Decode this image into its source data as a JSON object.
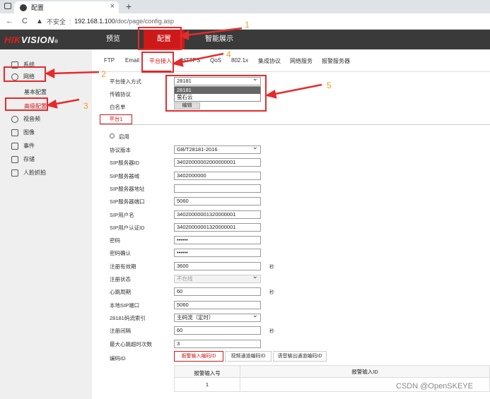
{
  "browser": {
    "tab_title": "配置",
    "new_tab_symbol": "+",
    "close_symbol": "×",
    "security_label": "不安全",
    "url_host": "192.168.1.100",
    "url_path": "/doc/page/config.asp"
  },
  "header": {
    "logo_red": "HIK",
    "logo_white": "VISION",
    "logo_mark": "®",
    "nav": [
      "预览",
      "配置",
      "智能展示"
    ]
  },
  "sidebar": {
    "items": [
      {
        "label": "系统",
        "icon": "monitor-icon"
      },
      {
        "label": "网络",
        "icon": "globe-icon"
      },
      {
        "label": "视音频",
        "icon": "av-icon"
      },
      {
        "label": "图像",
        "icon": "image-icon"
      },
      {
        "label": "事件",
        "icon": "calendar-icon"
      },
      {
        "label": "存储",
        "icon": "storage-icon"
      },
      {
        "label": "人脸抓拍",
        "icon": "face-icon"
      }
    ],
    "network_sub": [
      "基本配置",
      "高级配置"
    ]
  },
  "tabs": [
    "FTP",
    "Email",
    "平台接入",
    "HTTPS",
    "QoS",
    "802.1x",
    "集成协议",
    "网络服务",
    "报警服务器"
  ],
  "platform": {
    "access_label": "平台接入方式",
    "access_value": "28181",
    "transport_label": "传输协议",
    "whitelist_label": "白名单",
    "edit_button": "编辑",
    "dropdown_options": [
      "28181",
      "萤石云"
    ]
  },
  "subtab": "平台1",
  "enable_label": "启用",
  "form": [
    {
      "label": "协议版本",
      "value": "GB/T28181-2016",
      "type": "select"
    },
    {
      "label": "SIP服务器ID",
      "value": "34020000002000000001",
      "type": "text"
    },
    {
      "label": "SIP服务器域",
      "value": "3402000000",
      "type": "text"
    },
    {
      "label": "SIP服务器地址",
      "value": "",
      "type": "text"
    },
    {
      "label": "SIP服务器端口",
      "value": "5060",
      "type": "text"
    },
    {
      "label": "SIP用户名",
      "value": "34020000001320000001",
      "type": "text"
    },
    {
      "label": "SIP用户认证ID",
      "value": "34020000001320000001",
      "type": "text"
    },
    {
      "label": "密码",
      "value": "••••••",
      "type": "text"
    },
    {
      "label": "密码确认",
      "value": "••••••",
      "type": "text"
    },
    {
      "label": "注册有效期",
      "value": "3600",
      "type": "text",
      "unit": "秒"
    },
    {
      "label": "注册状态",
      "value": "不在线",
      "type": "select-disabled"
    },
    {
      "label": "心跳周期",
      "value": "60",
      "type": "text",
      "unit": "秒"
    },
    {
      "label": "本地SIP端口",
      "value": "5060",
      "type": "text"
    },
    {
      "label": "28181码流索引",
      "value": "主码流（定时）",
      "type": "select"
    },
    {
      "label": "注册间隔",
      "value": "60",
      "type": "text",
      "unit": "秒"
    },
    {
      "label": "最大心跳超时次数",
      "value": "3",
      "type": "text"
    }
  ],
  "encoding": {
    "label": "编码ID",
    "tabs": [
      "报警输入编码ID",
      "视频通道编码ID",
      "语音输出通道编码ID"
    ],
    "columns": [
      "报警输入号",
      "报警输入ID"
    ],
    "rows": [
      [
        "1",
        ""
      ]
    ]
  },
  "annotations": [
    "1",
    "2",
    "3",
    "4",
    "5"
  ],
  "watermark": "CSDN @OpenSKEYE",
  "colors": {
    "accent": "#cc1a1a",
    "annotation": "#e52b2b",
    "number": "#f0a020",
    "header": "#3a3a3a"
  }
}
